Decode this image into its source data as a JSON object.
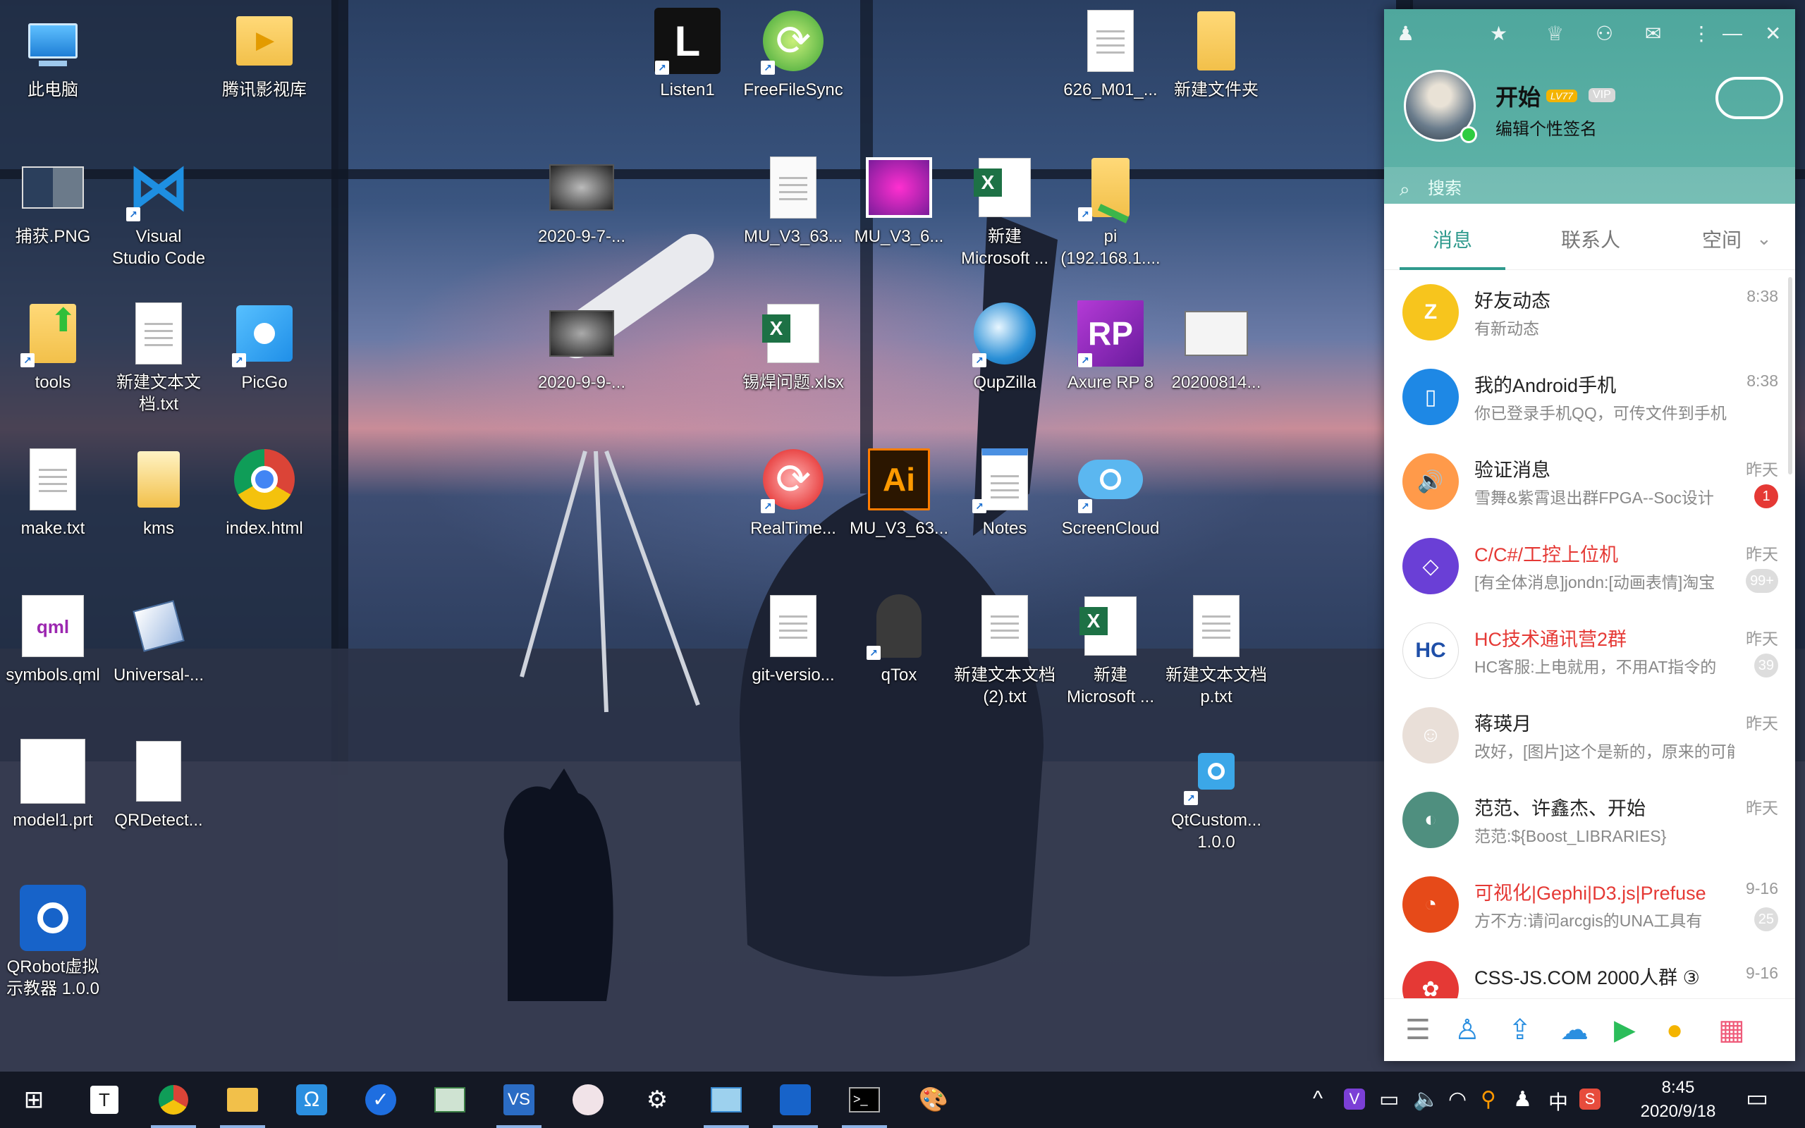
{
  "desktop": {
    "icons": [
      {
        "id": "this-pc",
        "label": "此电脑",
        "glyph": "🖥"
      },
      {
        "id": "tencent-video",
        "label": "腾讯影视库",
        "glyph": "▶"
      },
      {
        "id": "listen1",
        "label": "Listen1",
        "glyph": "L"
      },
      {
        "id": "freefilesync",
        "label": "FreeFileSync",
        "glyph": "⟳"
      },
      {
        "id": "file-626",
        "label": "626_M01_...",
        "glyph": ""
      },
      {
        "id": "new-folder",
        "label": "新建文件夹",
        "glyph": ""
      },
      {
        "id": "capture-png",
        "label": "捕获.PNG",
        "glyph": ""
      },
      {
        "id": "vscode",
        "label": "Visual\nStudio Code",
        "glyph": "⋈"
      },
      {
        "id": "img-2020-9-7",
        "label": "2020-9-7-...",
        "glyph": ""
      },
      {
        "id": "mu-v3-63-a",
        "label": "MU_V3_63...",
        "glyph": ""
      },
      {
        "id": "mu-v3-6",
        "label": "MU_V3_6...",
        "glyph": ""
      },
      {
        "id": "new-excel-1",
        "label": "新建\nMicrosoft ...",
        "glyph": "X"
      },
      {
        "id": "pi",
        "label": "pi\n(192.168.1....",
        "glyph": ""
      },
      {
        "id": "tools",
        "label": "tools",
        "glyph": ""
      },
      {
        "id": "new-txt-1",
        "label": "新建文本文\n档.txt",
        "glyph": ""
      },
      {
        "id": "picgo",
        "label": "PicGo",
        "glyph": ""
      },
      {
        "id": "img-2020-9-9",
        "label": "2020-9-9-...",
        "glyph": ""
      },
      {
        "id": "solder-xlsx",
        "label": "锡焊问题.xlsx",
        "glyph": "X"
      },
      {
        "id": "qupzilla",
        "label": "QupZilla",
        "glyph": ""
      },
      {
        "id": "axure",
        "label": "Axure RP 8",
        "glyph": "RP"
      },
      {
        "id": "img-20200814",
        "label": "20200814...",
        "glyph": ""
      },
      {
        "id": "make-txt",
        "label": "make.txt",
        "glyph": ""
      },
      {
        "id": "kms",
        "label": "kms",
        "glyph": ""
      },
      {
        "id": "index-html",
        "label": "index.html",
        "glyph": ""
      },
      {
        "id": "realtime",
        "label": "RealTime...",
        "glyph": "⟳"
      },
      {
        "id": "mu-v3-63-ai",
        "label": "MU_V3_63...",
        "glyph": "Ai"
      },
      {
        "id": "notes",
        "label": "Notes",
        "glyph": ""
      },
      {
        "id": "screencloud",
        "label": "ScreenCloud",
        "glyph": ""
      },
      {
        "id": "symbols-qml",
        "label": "symbols.qml",
        "glyph": "qml"
      },
      {
        "id": "universal",
        "label": "Universal-...",
        "glyph": ""
      },
      {
        "id": "git-version",
        "label": "git-versio...",
        "glyph": ""
      },
      {
        "id": "qtox",
        "label": "qTox",
        "glyph": ""
      },
      {
        "id": "new-txt-2",
        "label": "新建文本文档\n(2).txt",
        "glyph": ""
      },
      {
        "id": "new-excel-2",
        "label": "新建\nMicrosoft ...",
        "glyph": "X"
      },
      {
        "id": "new-txt-p",
        "label": "新建文本文档\np.txt",
        "glyph": ""
      },
      {
        "id": "model1-prt",
        "label": "model1.prt",
        "glyph": ""
      },
      {
        "id": "qrdetect",
        "label": "QRDetect...",
        "glyph": ""
      },
      {
        "id": "qtcustom",
        "label": "QtCustom...\n1.0.0",
        "glyph": ""
      },
      {
        "id": "qrobot",
        "label": "QRobot虚拟\n示教器 1.0.0",
        "glyph": ""
      }
    ]
  },
  "qq": {
    "nickname": "开始",
    "level_badge": "LV77",
    "vip_badge": "VIP",
    "signature": "编辑个性签名",
    "search_placeholder": "搜索",
    "tabs": [
      "消息",
      "联系人",
      "空间"
    ],
    "conversations": [
      {
        "name": "好友动态",
        "msg": "有新动态",
        "time": "8:38",
        "badge": "",
        "color": "#f7c51d",
        "glyph": "Z",
        "name_color": "#222"
      },
      {
        "name": "我的Android手机",
        "msg": "你已登录手机QQ，可传文件到手机",
        "time": "8:38",
        "badge": "",
        "color": "#1e88e5",
        "glyph": "▯",
        "name_color": "#222"
      },
      {
        "name": "验证消息",
        "msg": "雪舞&紫霄退出群FPGA--Soc设计",
        "time": "昨天",
        "badge": "1",
        "color": "#ff9a4a",
        "glyph": "🔊",
        "name_color": "#222"
      },
      {
        "name": "C/C#/工控上位机",
        "msg": "[有全体消息]jondn:[动画表情]淘宝",
        "time": "昨天",
        "badge": "99+",
        "color": "#6a3fd6",
        "glyph": "◇",
        "name_color": "#e53935"
      },
      {
        "name": "HC技术通讯营2群",
        "msg": "HC客服:上电就用，不用AT指令的",
        "time": "昨天",
        "badge": "39",
        "color": "#ffffff",
        "glyph": "HC",
        "name_color": "#e53935"
      },
      {
        "name": "蒋瑛月",
        "msg": "改好，[图片]这个是新的，原来的可能像",
        "time": "昨天",
        "badge": "",
        "color": "#e9dfd8",
        "glyph": "☺",
        "name_color": "#222"
      },
      {
        "name": "范范、许鑫杰、开始",
        "msg": "范范:${Boost_LIBRARIES}",
        "time": "昨天",
        "badge": "",
        "color": "#4f8f7f",
        "glyph": "◐",
        "name_color": "#222"
      },
      {
        "name": "可视化|Gephi|D3.js|Prefuse",
        "msg": "方不方:请问arcgis的UNA工具有",
        "time": "9-16",
        "badge": "25",
        "color": "#e64a19",
        "glyph": "◔",
        "name_color": "#e53935"
      },
      {
        "name": "CSS-JS.COM 2000人群 ③",
        "msg": "",
        "time": "9-16",
        "badge": "",
        "color": "#e53935",
        "glyph": "✿",
        "name_color": "#222"
      }
    ]
  },
  "taskbar": {
    "time": "8:45",
    "date": "2020/9/18",
    "ime": "中",
    "apps": [
      "windows-start",
      "typora",
      "chrome",
      "file-explorer",
      "omega",
      "vscode-alt",
      "screen",
      "vs-code",
      "mascot",
      "settings",
      "qtcreator",
      "qrobot",
      "terminal",
      "paint"
    ]
  }
}
